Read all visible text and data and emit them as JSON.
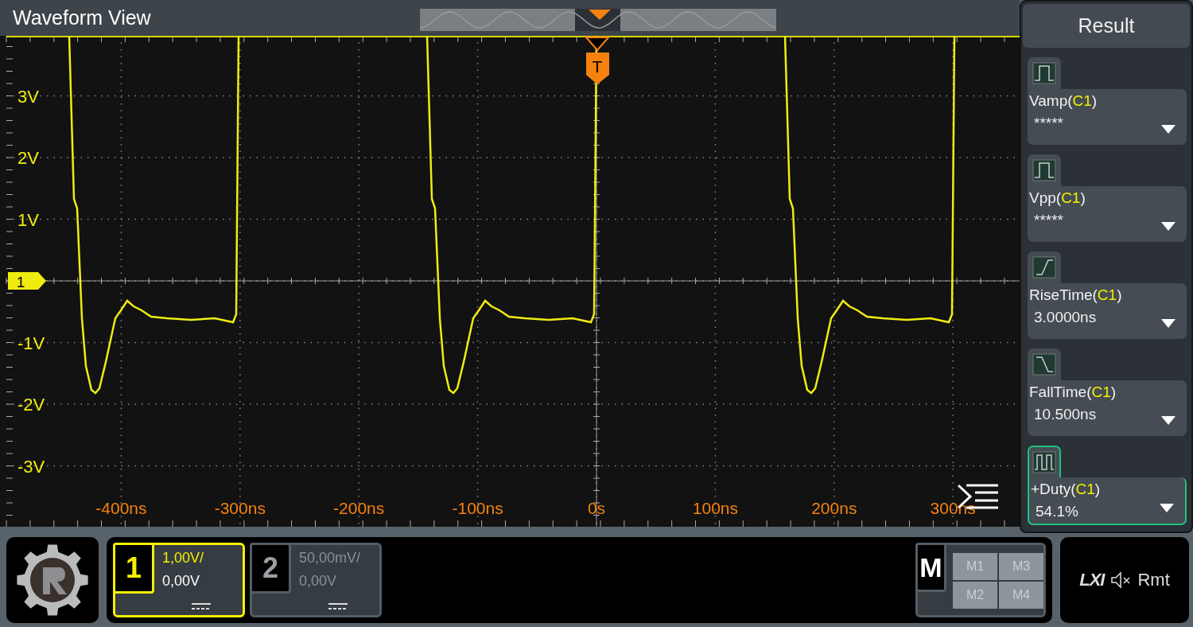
{
  "header": {
    "title": "Waveform View"
  },
  "trigger_marker": {
    "label": "T"
  },
  "channel_marker": {
    "label": "1"
  },
  "y_axis_labels": [
    "3V",
    "2V",
    "1V",
    "-1V",
    "-2V",
    "-3V"
  ],
  "x_axis_labels": [
    "-400ns",
    "-300ns",
    "-200ns",
    "-100ns",
    "0s",
    "100ns",
    "200ns",
    "300ns"
  ],
  "result_panel": {
    "title": "Result",
    "measurements": [
      {
        "kind": "pulse",
        "name": "Vamp(",
        "source": "C1",
        "close": ")",
        "value": "*****",
        "selected": false
      },
      {
        "kind": "pulse",
        "name": "Vpp(",
        "source": "C1",
        "close": ")",
        "value": "*****",
        "selected": false
      },
      {
        "kind": "rise",
        "name": "RiseTime(",
        "source": "C1",
        "close": ")",
        "value": "3.0000ns",
        "selected": false
      },
      {
        "kind": "fall",
        "name": "FallTime(",
        "source": "C1",
        "close": ")",
        "value": "10.500ns",
        "selected": false
      },
      {
        "kind": "duty",
        "name": "+Duty(",
        "source": "C1",
        "close": ")",
        "value": "54.1%",
        "selected": true
      }
    ]
  },
  "channels": [
    {
      "number": "1",
      "scale": "1,00V/",
      "offset": "0,00V",
      "selected": true
    },
    {
      "number": "2",
      "scale": "50,00mV/",
      "offset": "0,00V",
      "selected": false
    }
  ],
  "math": {
    "label": "M",
    "buttons": [
      "M1",
      "M3",
      "M2",
      "M4"
    ]
  },
  "status": {
    "lxi": "LXI",
    "remote": "Rmt"
  }
}
